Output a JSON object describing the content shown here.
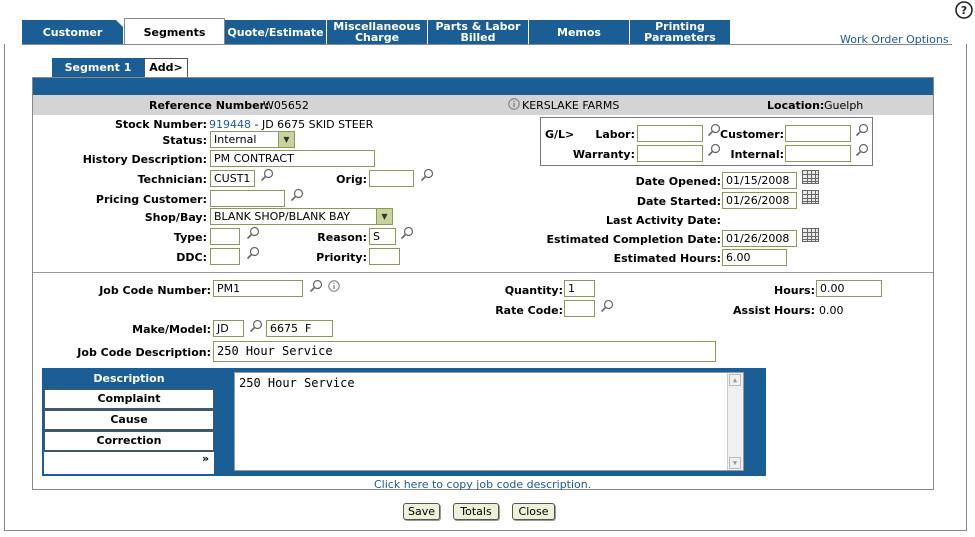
{
  "help_icon": "help-icon",
  "tabs": [
    {
      "label": "Customer",
      "active": false
    },
    {
      "label": "Segments",
      "active": true
    },
    {
      "label": "Quote/Estimate",
      "active": false
    },
    {
      "label": "Miscellaneous\nCharge",
      "active": false
    },
    {
      "label": "Parts & Labor\nBilled",
      "active": false
    },
    {
      "label": "Memos",
      "active": false
    },
    {
      "label": "Printing\nParameters",
      "active": false
    }
  ],
  "work_order_options": "Work Order Options",
  "segment_tabs": [
    {
      "label": "Segment 1"
    },
    {
      "label": "Add>"
    }
  ],
  "header": {
    "reference_label": "Reference Number:",
    "reference_value": "W05652",
    "customer_name": "KERSLAKE FARMS",
    "location_label": "Location:",
    "location_value": "Guelph"
  },
  "segment": {
    "stock_label": "Stock Number:",
    "stock_link": "919448",
    "stock_desc": " - JD 6675 SKID STEER",
    "status_label": "Status:",
    "status_value": "Internal",
    "history_label": "History Description:",
    "history_value": "PM CONTRACT",
    "technician_label": "Technician:",
    "technician_value": "CUST1",
    "orig_label": "Orig:",
    "orig_value": "",
    "pricing_label": "Pricing Customer:",
    "pricing_value": "",
    "shop_label": "Shop/Bay:",
    "shop_value": "BLANK SHOP/BLANK BAY",
    "type_label": "Type:",
    "type_value": "",
    "reason_label": "Reason:",
    "reason_value": "S",
    "ddc_label": "DDC:",
    "ddc_value": "",
    "priority_label": "Priority:",
    "priority_value": ""
  },
  "gl": {
    "title": "G/L>",
    "labor_label": "Labor:",
    "labor_value": "",
    "customer_label": "Customer:",
    "customer_value": "",
    "warranty_label": "Warranty:",
    "warranty_value": "",
    "internal_label": "Internal:",
    "internal_value": ""
  },
  "dates": {
    "opened_label": "Date Opened:",
    "opened_value": "01/15/2008",
    "started_label": "Date Started:",
    "started_value": "01/26/2008",
    "last_activity_label": "Last Activity Date:",
    "last_activity_value": "",
    "est_completion_label": "Estimated Completion Date:",
    "est_completion_value": "01/26/2008",
    "est_hours_label": "Estimated Hours:",
    "est_hours_value": "6.00"
  },
  "job": {
    "code_label": "Job Code Number:",
    "code_value": "PM1",
    "quantity_label": "Quantity:",
    "quantity_value": "1",
    "rate_label": "Rate Code:",
    "rate_value": "",
    "hours_label": "Hours:",
    "hours_value": "0.00",
    "assist_label": "Assist Hours:",
    "assist_value": "0.00",
    "make_label": "Make/Model:",
    "make_value": "JD",
    "model_value": "6675  F",
    "desc_label": "Job Code Description:",
    "desc_value": "250 Hour Service"
  },
  "notes": {
    "buttons": [
      "Description",
      "Complaint",
      "Cause",
      "Correction"
    ],
    "more": "»",
    "text": "250 Hour Service"
  },
  "copy_link": "Click here to copy job code description.",
  "actions": {
    "save": "Save",
    "totals": "Totals",
    "close": "Close"
  },
  "colors": {
    "tab_blue": "#1b5e96",
    "link": "#1a5a9a",
    "input_border": "#8a9a5a",
    "gray_band": "#d4d4d4"
  }
}
